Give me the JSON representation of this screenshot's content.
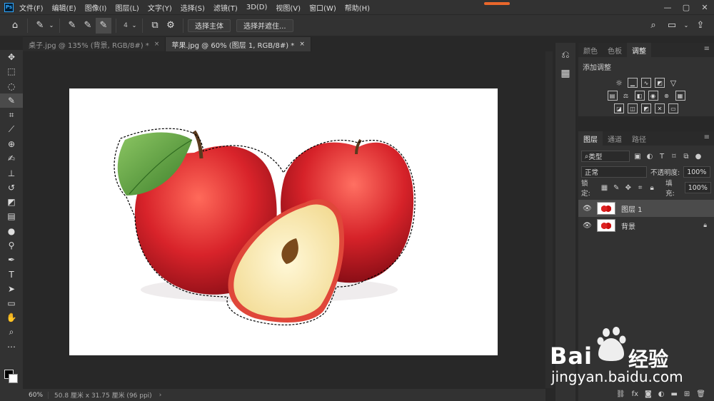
{
  "menubar": {
    "logo": "Ps",
    "items": [
      "文件(F)",
      "编辑(E)",
      "图像(I)",
      "图层(L)",
      "文字(Y)",
      "选择(S)",
      "滤镜(T)",
      "3D(D)",
      "视图(V)",
      "窗口(W)",
      "帮助(H)"
    ],
    "window_controls": [
      "—",
      "▢",
      "✕"
    ]
  },
  "options": {
    "brush_size": "4",
    "select_subject": "选择主体",
    "select_and_mask": "选择并遮住..."
  },
  "tabs": [
    {
      "label": "桌子.jpg @ 135% (背景, RGB/8#) *",
      "close": "×"
    },
    {
      "label": "苹果.jpg @ 60% (图层 1, RGB/8#) *",
      "close": "×"
    }
  ],
  "status": {
    "zoom": "60%",
    "info": "50.8 厘米 x 31.75 厘米 (96 ppi)",
    "chevron": "›"
  },
  "adjust_panel": {
    "tabs": [
      "颜色",
      "色板",
      "调整"
    ],
    "title": "添加调整"
  },
  "layers_panel": {
    "tabs": [
      "图层",
      "通道",
      "路径"
    ],
    "filter": "类型",
    "blend_mode": "正常",
    "opacity_label": "不透明度:",
    "opacity": "100%",
    "lock_label": "锁定:",
    "fill_label": "填充:",
    "fill": "100%",
    "layers": [
      {
        "name": "图层 1",
        "selected": true,
        "locked": false
      },
      {
        "name": "背景",
        "selected": false,
        "locked": true
      }
    ]
  },
  "watermark": {
    "brand": "Bai",
    "brand_cn": "经验",
    "url": "jingyan.baidu.com"
  },
  "colors": {
    "accent": "#31a8ff",
    "panel": "#323232",
    "canvas_bg": "#282828"
  }
}
